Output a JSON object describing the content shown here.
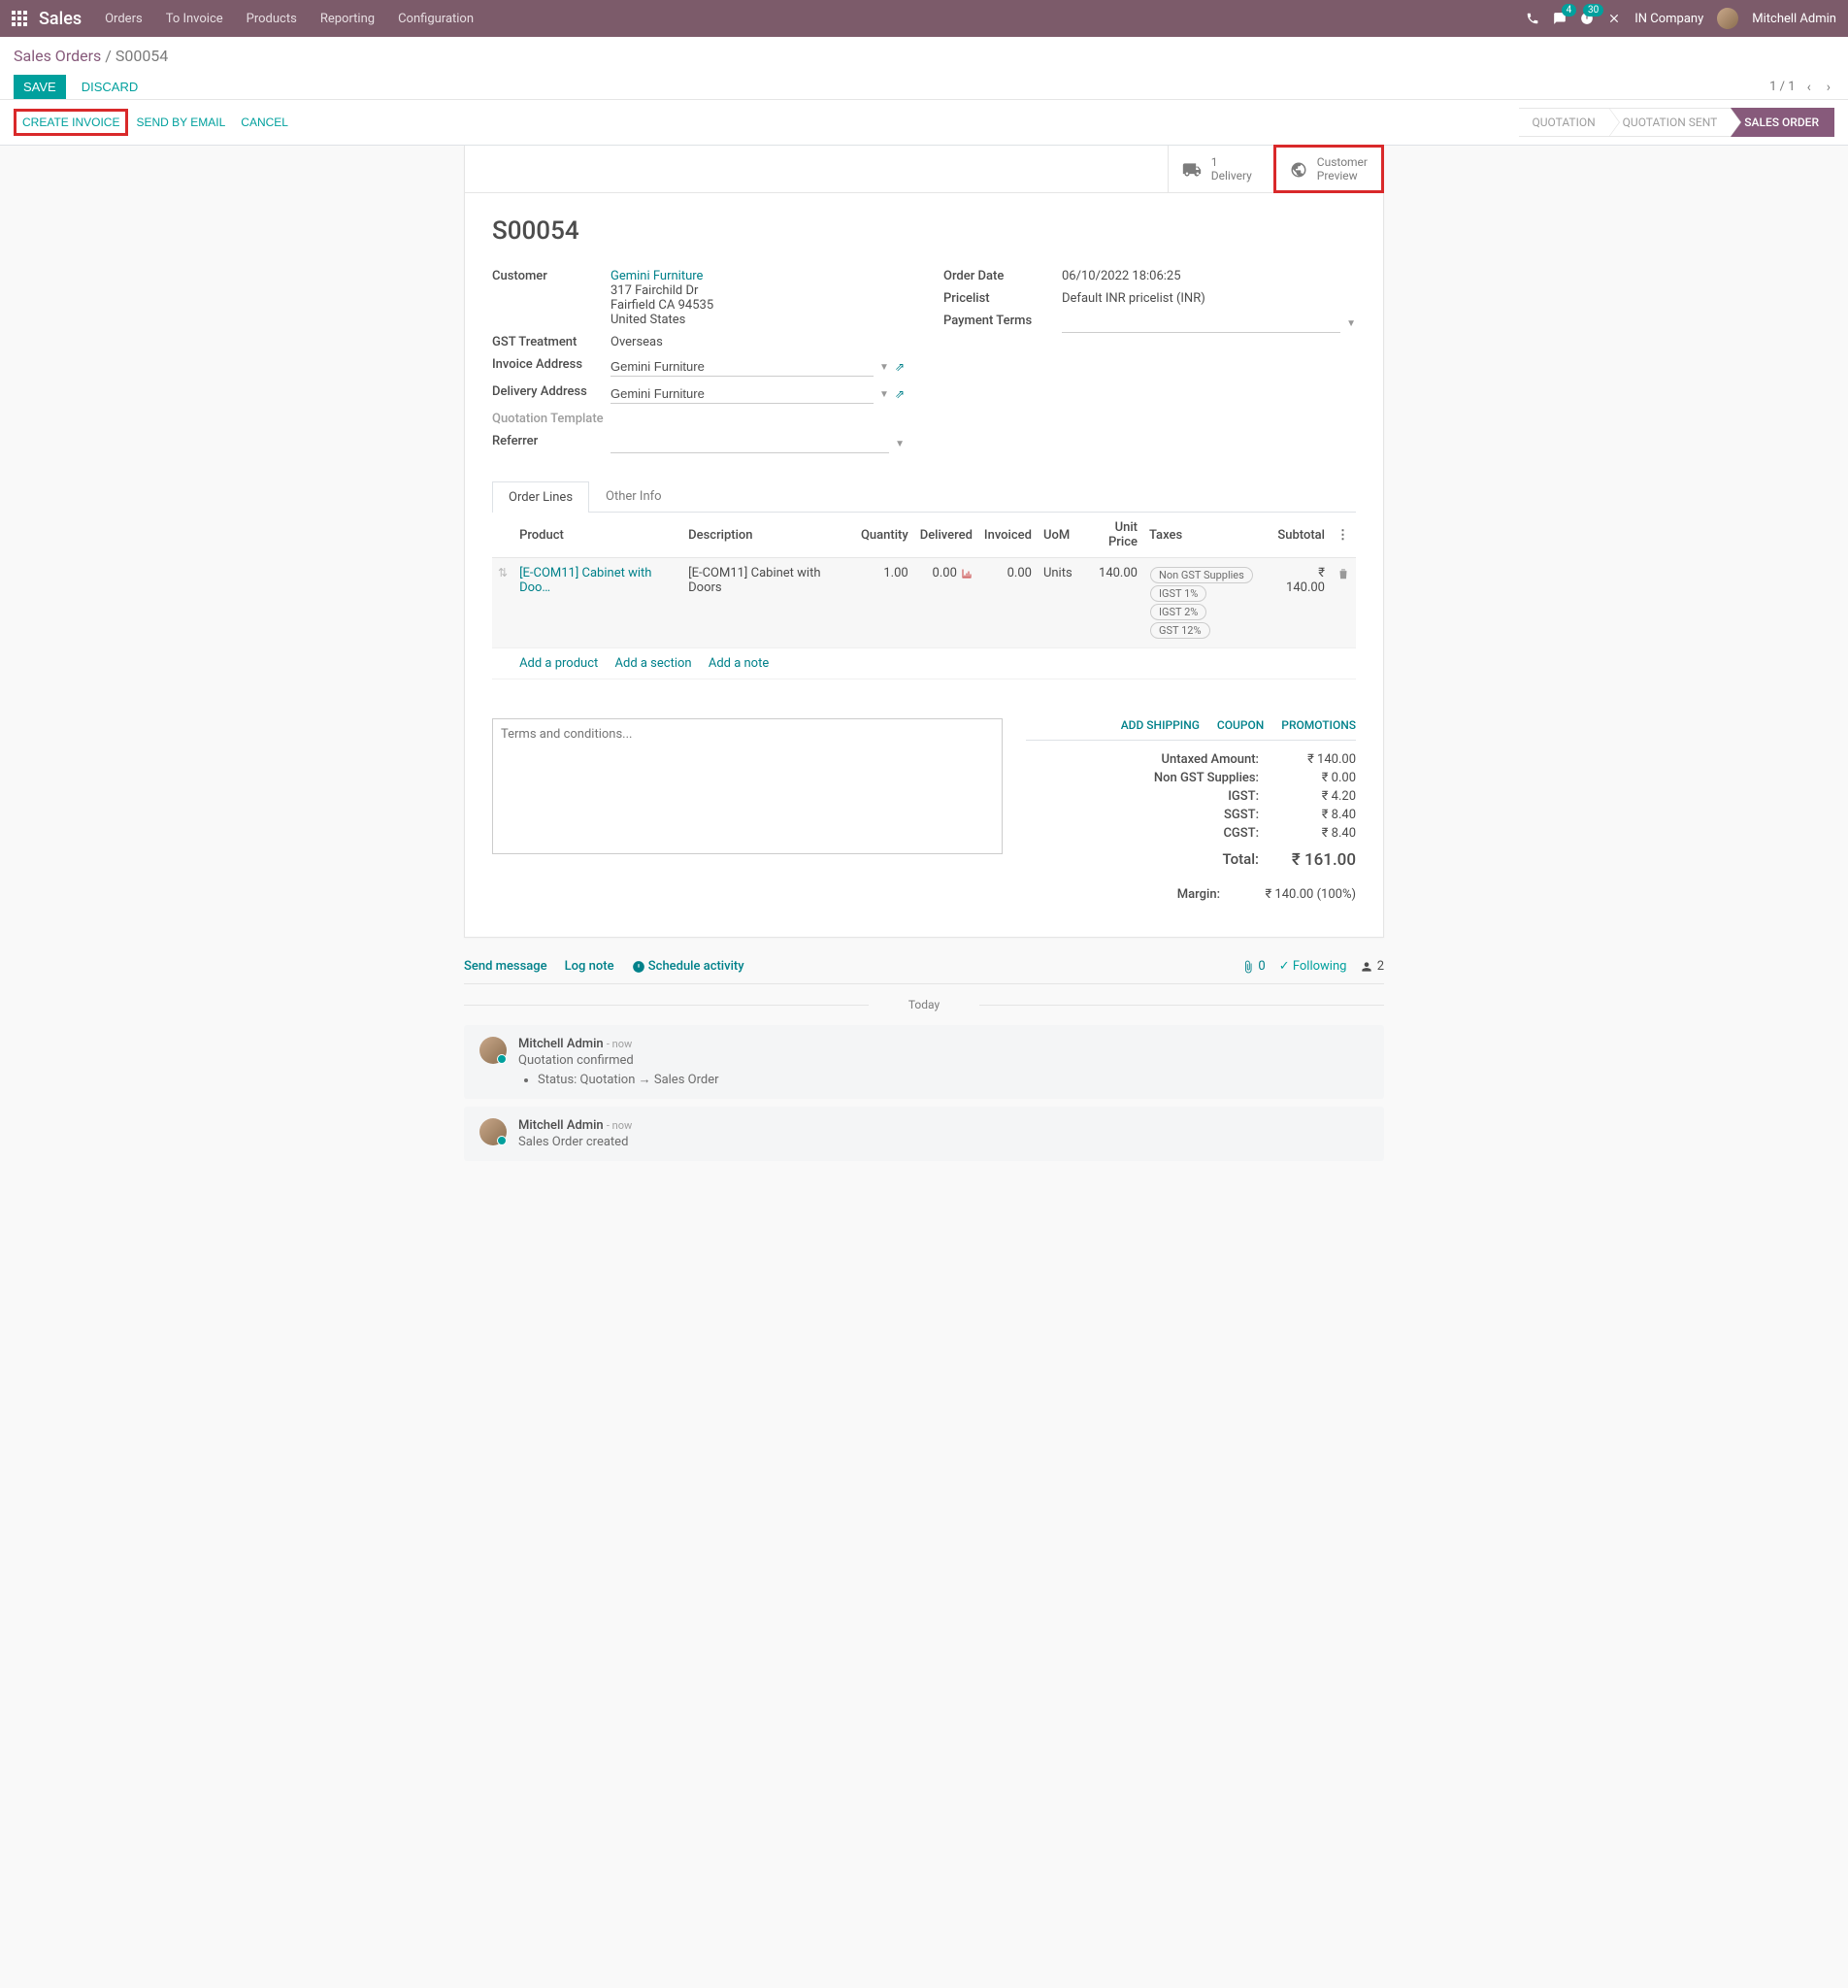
{
  "topbar": {
    "brand": "Sales",
    "nav": [
      "Orders",
      "To Invoice",
      "Products",
      "Reporting",
      "Configuration"
    ],
    "chat_badge": "4",
    "activity_badge": "30",
    "company": "IN Company",
    "user": "Mitchell Admin"
  },
  "breadcrumb": {
    "root": "Sales Orders",
    "current": "S00054"
  },
  "buttons": {
    "save": "SAVE",
    "discard": "DISCARD",
    "create_invoice": "CREATE INVOICE",
    "send_email": "SEND BY EMAIL",
    "cancel": "CANCEL"
  },
  "pager": {
    "text": "1 / 1"
  },
  "status": {
    "quotation": "QUOTATION",
    "quotation_sent": "QUOTATION SENT",
    "sales_order": "SALES ORDER"
  },
  "statbuttons": {
    "delivery": {
      "count": "1",
      "label": "Delivery"
    },
    "preview": {
      "line1": "Customer",
      "line2": "Preview"
    }
  },
  "order": {
    "number": "S00054",
    "customer_label": "Customer",
    "customer_name": "Gemini Furniture",
    "customer_addr1": "317 Fairchild Dr",
    "customer_addr2": "Fairfield CA 94535",
    "customer_addr3": "United States",
    "gst_label": "GST Treatment",
    "gst_val": "Overseas",
    "invoice_addr_label": "Invoice Address",
    "invoice_addr_val": "Gemini Furniture",
    "delivery_addr_label": "Delivery Address",
    "delivery_addr_val": "Gemini Furniture",
    "qtpl_label": "Quotation Template",
    "referrer_label": "Referrer",
    "order_date_label": "Order Date",
    "order_date_val": "06/10/2022 18:06:25",
    "pricelist_label": "Pricelist",
    "pricelist_val": "Default INR pricelist (INR)",
    "payment_terms_label": "Payment Terms"
  },
  "tabs": {
    "lines": "Order Lines",
    "other": "Other Info"
  },
  "table": {
    "headers": {
      "product": "Product",
      "desc": "Description",
      "qty": "Quantity",
      "delivered": "Delivered",
      "invoiced": "Invoiced",
      "uom": "UoM",
      "unit_price": "Unit Price",
      "taxes": "Taxes",
      "subtotal": "Subtotal"
    },
    "row": {
      "product": "[E-COM11] Cabinet with Doo…",
      "desc": "[E-COM11] Cabinet with Doors",
      "qty": "1.00",
      "delivered": "0.00",
      "invoiced": "0.00",
      "uom": "Units",
      "unit_price": "140.00",
      "taxes": [
        "Non GST Supplies",
        "IGST 1%",
        "IGST 2%",
        "GST 12%"
      ],
      "subtotal": "₹ 140.00"
    },
    "actions": {
      "add_product": "Add a product",
      "add_section": "Add a section",
      "add_note": "Add a note"
    }
  },
  "terms_placeholder": "Terms and conditions...",
  "total_links": {
    "shipping": "ADD SHIPPING",
    "coupon": "COUPON",
    "promo": "PROMOTIONS"
  },
  "totals": {
    "untaxed_label": "Untaxed Amount:",
    "untaxed": "₹ 140.00",
    "nongst_label": "Non GST Supplies:",
    "nongst": "₹ 0.00",
    "igst_label": "IGST:",
    "igst": "₹ 4.20",
    "sgst_label": "SGST:",
    "sgst": "₹ 8.40",
    "cgst_label": "CGST:",
    "cgst": "₹ 8.40",
    "total_label": "Total:",
    "total": "₹ 161.00",
    "margin_label": "Margin:",
    "margin": "₹ 140.00 (100%)"
  },
  "chatter": {
    "send": "Send message",
    "log": "Log note",
    "schedule": "Schedule activity",
    "attach_count": "0",
    "following": "Following",
    "followers": "2",
    "today": "Today",
    "msg1": {
      "author": "Mitchell Admin",
      "time": "- now",
      "text": "Quotation confirmed",
      "status_change": "Status: Quotation → Sales Order"
    },
    "msg2": {
      "author": "Mitchell Admin",
      "time": "- now",
      "text": "Sales Order created"
    }
  }
}
